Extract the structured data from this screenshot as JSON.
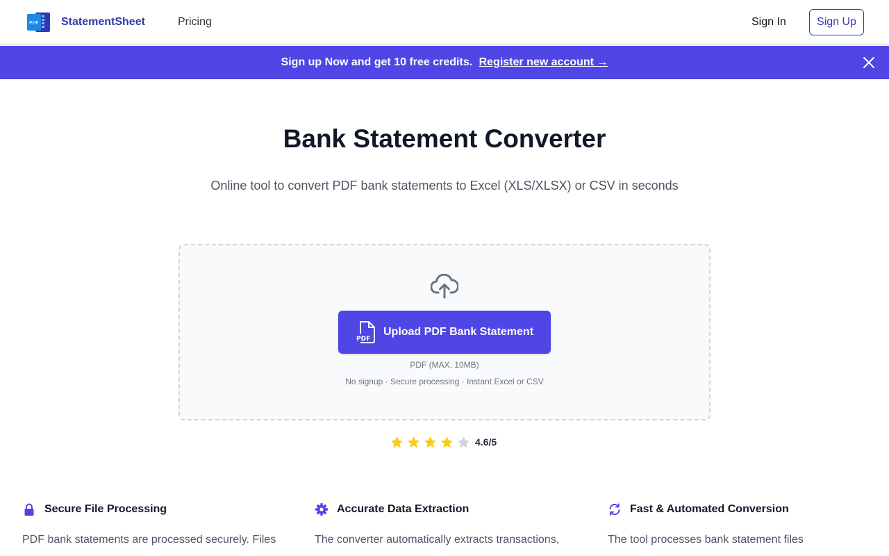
{
  "header": {
    "brand": "StatementSheet",
    "nav_pricing": "Pricing",
    "sign_in": "Sign In",
    "sign_up": "Sign Up",
    "logo_icon": "pdf-document-logo-icon"
  },
  "banner": {
    "text": "Sign up Now and get 10 free credits.",
    "link": "Register new account →",
    "close_icon": "close-icon"
  },
  "hero": {
    "title": "Bank Statement Converter",
    "subtitle": "Online tool to convert PDF bank statements to Excel (XLS/XLSX) or CSV in seconds"
  },
  "upload": {
    "button_label": "Upload PDF Bank Statement",
    "file_hint": "PDF (MAX. 10MB)",
    "features_hint": "No signup · Secure processing · Instant Excel or CSV",
    "icons": [
      "cloud-upload-icon",
      "pdf-file-icon"
    ]
  },
  "rating": {
    "value": "4.6/5",
    "stars": 4,
    "max_stars": 5,
    "star_color": "#facc15",
    "empty_star_color": "#d1d5db"
  },
  "features": [
    {
      "icon": "lock-icon",
      "title": "Secure File Processing",
      "desc": "PDF bank statements are processed securely. Files"
    },
    {
      "icon": "gear-icon",
      "title": "Accurate Data Extraction",
      "desc": "The converter automatically extracts transactions,"
    },
    {
      "icon": "refresh-icon",
      "title": "Fast & Automated Conversion",
      "desc": "The tool processes bank statement files"
    }
  ],
  "colors": {
    "accent": "#4f46e5",
    "brand": "#2e3aa8"
  }
}
